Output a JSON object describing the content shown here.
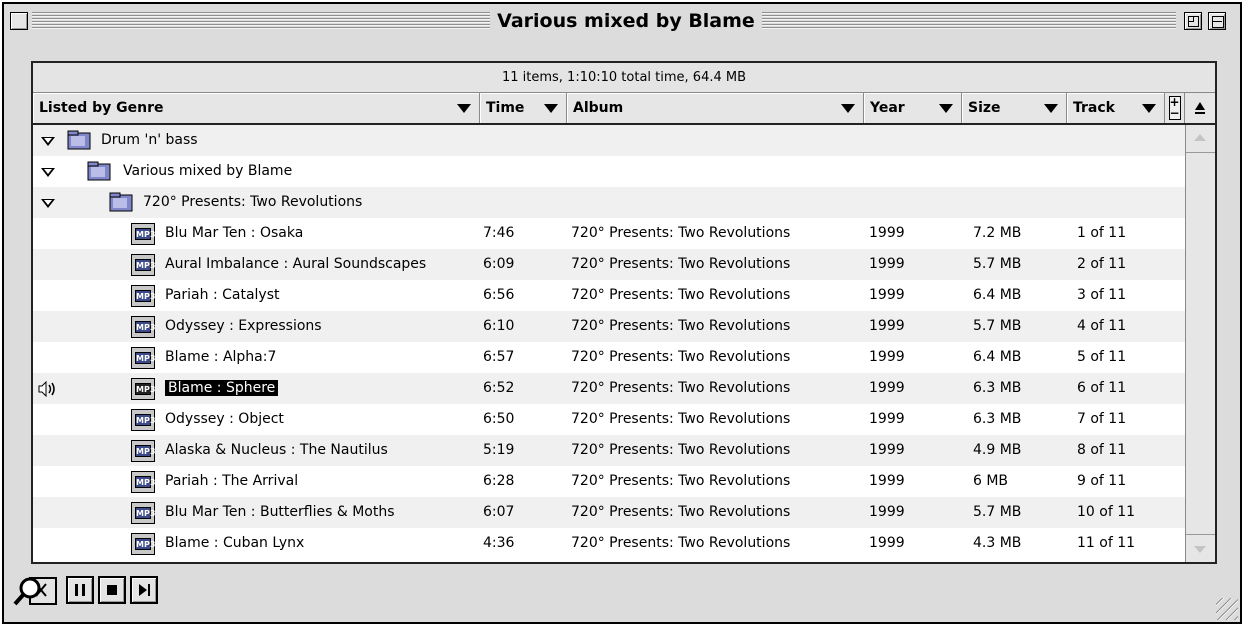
{
  "window": {
    "title": "Various mixed by Blame"
  },
  "info_bar": "11 items, 1:10:10 total time, 64.4 MB",
  "columns": {
    "genre": "Listed by Genre",
    "time": "Time",
    "album": "Album",
    "year": "Year",
    "size": "Size",
    "track": "Track"
  },
  "groups": [
    {
      "label": "Drum 'n' bass",
      "level": 0
    },
    {
      "label": "Various mixed by Blame",
      "level": 1
    },
    {
      "label": "720° Presents: Two Revolutions",
      "level": 2
    }
  ],
  "tracks": [
    {
      "name": "Blu Mar Ten : Osaka",
      "time": "7:46",
      "album": "720° Presents: Two Revolutions",
      "year": "1999",
      "size": "7.2 MB",
      "track": "1 of 11"
    },
    {
      "name": "Aural Imbalance : Aural Soundscapes",
      "time": "6:09",
      "album": "720° Presents: Two Revolutions",
      "year": "1999",
      "size": "5.7 MB",
      "track": "2 of 11"
    },
    {
      "name": "Pariah : Catalyst",
      "time": "6:56",
      "album": "720° Presents: Two Revolutions",
      "year": "1999",
      "size": "6.4 MB",
      "track": "3 of 11"
    },
    {
      "name": "Odyssey : Expressions",
      "time": "6:10",
      "album": "720° Presents: Two Revolutions",
      "year": "1999",
      "size": "5.7 MB",
      "track": "4 of 11"
    },
    {
      "name": "Blame : Alpha:7",
      "time": "6:57",
      "album": "720° Presents: Two Revolutions",
      "year": "1999",
      "size": "6.4 MB",
      "track": "5 of 11"
    },
    {
      "name": "Blame : Sphere",
      "time": "6:52",
      "album": "720° Presents: Two Revolutions",
      "year": "1999",
      "size": "6.3 MB",
      "track": "6 of 11",
      "selected": true,
      "playing": true
    },
    {
      "name": "Odyssey : Object",
      "time": "6:50",
      "album": "720° Presents: Two Revolutions",
      "year": "1999",
      "size": "6.3 MB",
      "track": "7 of 11"
    },
    {
      "name": "Alaska & Nucleus : The Nautilus",
      "time": "5:19",
      "album": "720° Presents: Two Revolutions",
      "year": "1999",
      "size": "4.9 MB",
      "track": "8 of 11"
    },
    {
      "name": "Pariah : The Arrival",
      "time": "6:28",
      "album": "720° Presents: Two Revolutions",
      "year": "1999",
      "size": "6 MB",
      "track": "9 of 11"
    },
    {
      "name": "Blu Mar Ten : Butterflies & Moths",
      "time": "6:07",
      "album": "720° Presents: Two Revolutions",
      "year": "1999",
      "size": "5.7 MB",
      "track": "10 of 11"
    },
    {
      "name": "Blame : Cuban Lynx",
      "time": "4:36",
      "album": "720° Presents: Two Revolutions",
      "year": "1999",
      "size": "4.3 MB",
      "track": "11 of 11"
    }
  ],
  "file_icon_label": "MP3",
  "icons": {
    "folder": "folder-icon",
    "file": "mp3-file-icon",
    "playing": "speaker-icon",
    "controls": [
      "search-icon",
      "pause-icon",
      "stop-icon",
      "next-track-icon"
    ]
  },
  "colors": {
    "window_bg": "#dcdcdc",
    "selection": "#000000",
    "folder": "#7f86c9"
  }
}
